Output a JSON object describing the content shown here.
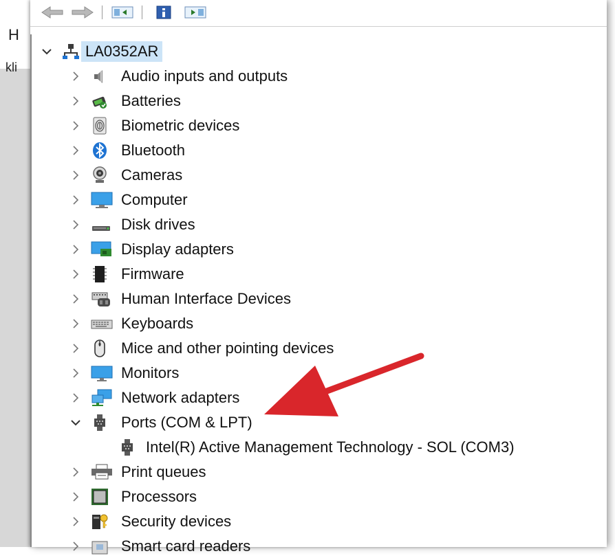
{
  "background_window": {
    "text_top": "H",
    "text_side": "kli"
  },
  "toolbar": {
    "buttons": [
      "back-icon",
      "forward-icon",
      "show-hide-console-tree-icon",
      "properties-icon",
      "show-action-pane-icon"
    ]
  },
  "tree": {
    "root": "LA0352AR",
    "categories": [
      {
        "label": "Audio inputs and outputs",
        "icon": "speaker-icon",
        "expanded": false
      },
      {
        "label": "Batteries",
        "icon": "battery-icon",
        "expanded": false
      },
      {
        "label": "Biometric devices",
        "icon": "fingerprint-icon",
        "expanded": false
      },
      {
        "label": "Bluetooth",
        "icon": "bluetooth-icon",
        "expanded": false
      },
      {
        "label": "Cameras",
        "icon": "webcam-icon",
        "expanded": false
      },
      {
        "label": "Computer",
        "icon": "computer-monitor-icon",
        "expanded": false
      },
      {
        "label": "Disk drives",
        "icon": "disk-drive-icon",
        "expanded": false
      },
      {
        "label": "Display adapters",
        "icon": "display-adapter-icon",
        "expanded": false
      },
      {
        "label": "Firmware",
        "icon": "chip-icon",
        "expanded": false
      },
      {
        "label": "Human Interface Devices",
        "icon": "hid-icon",
        "expanded": false
      },
      {
        "label": "Keyboards",
        "icon": "keyboard-icon",
        "expanded": false
      },
      {
        "label": "Mice and other pointing devices",
        "icon": "mouse-icon",
        "expanded": false
      },
      {
        "label": "Monitors",
        "icon": "monitor-icon",
        "expanded": false
      },
      {
        "label": "Network adapters",
        "icon": "network-adapter-icon",
        "expanded": false
      },
      {
        "label": "Ports (COM & LPT)",
        "icon": "port-icon",
        "expanded": true,
        "children": [
          {
            "label": "Intel(R) Active Management Technology - SOL (COM3)",
            "icon": "port-icon"
          }
        ]
      },
      {
        "label": "Print queues",
        "icon": "printer-icon",
        "expanded": false
      },
      {
        "label": "Processors",
        "icon": "processor-icon",
        "expanded": false
      },
      {
        "label": "Security devices",
        "icon": "security-device-icon",
        "expanded": false
      },
      {
        "label": "Smart card readers",
        "icon": "smart-card-reader-icon",
        "expanded": false
      }
    ]
  },
  "colors": {
    "selection": "#cce4f7",
    "annotation_arrow": "#d9262b",
    "accent_blue": "#1e73d2"
  }
}
